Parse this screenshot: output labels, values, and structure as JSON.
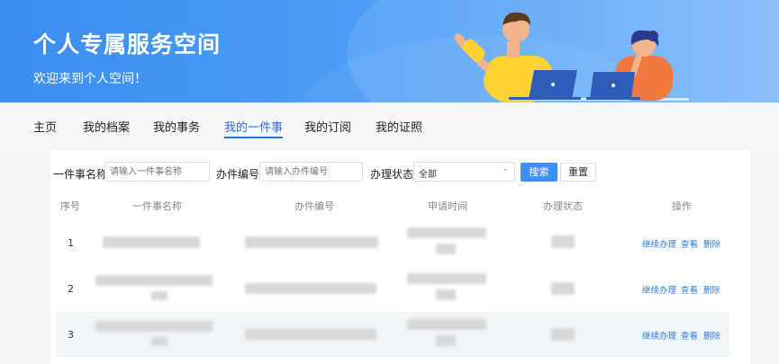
{
  "banner": {
    "title": "个人专属服务空间",
    "subtitle": "欢迎来到个人空间！"
  },
  "tabs": [
    {
      "label": "主页"
    },
    {
      "label": "我的档案"
    },
    {
      "label": "我的事务"
    },
    {
      "label": "我的一件事",
      "active": true
    },
    {
      "label": "我的订阅"
    },
    {
      "label": "我的证照"
    }
  ],
  "filters": {
    "name_label": "一件事名称",
    "name_placeholder": "请输入一件事名称",
    "code_label": "办件编号",
    "code_placeholder": "请输入办件编号",
    "status_label": "办理状态",
    "status_value": "全部",
    "search_label": "搜索",
    "reset_label": "重置"
  },
  "table": {
    "columns": [
      "序号",
      "一件事名称",
      "办件编号",
      "申请时间",
      "办理状态",
      "操作"
    ],
    "rows": [
      {
        "seq": "1",
        "actions": [
          "继续办理",
          "查看",
          "删除"
        ]
      },
      {
        "seq": "2",
        "actions": [
          "继续办理",
          "查看",
          "删除"
        ]
      },
      {
        "seq": "3",
        "actions": [
          "继续办理",
          "查看",
          "删除"
        ]
      }
    ]
  },
  "colors": {
    "accent": "#2f6fd6",
    "button": "#3d8ef5",
    "banner": "#3a8ef0"
  }
}
